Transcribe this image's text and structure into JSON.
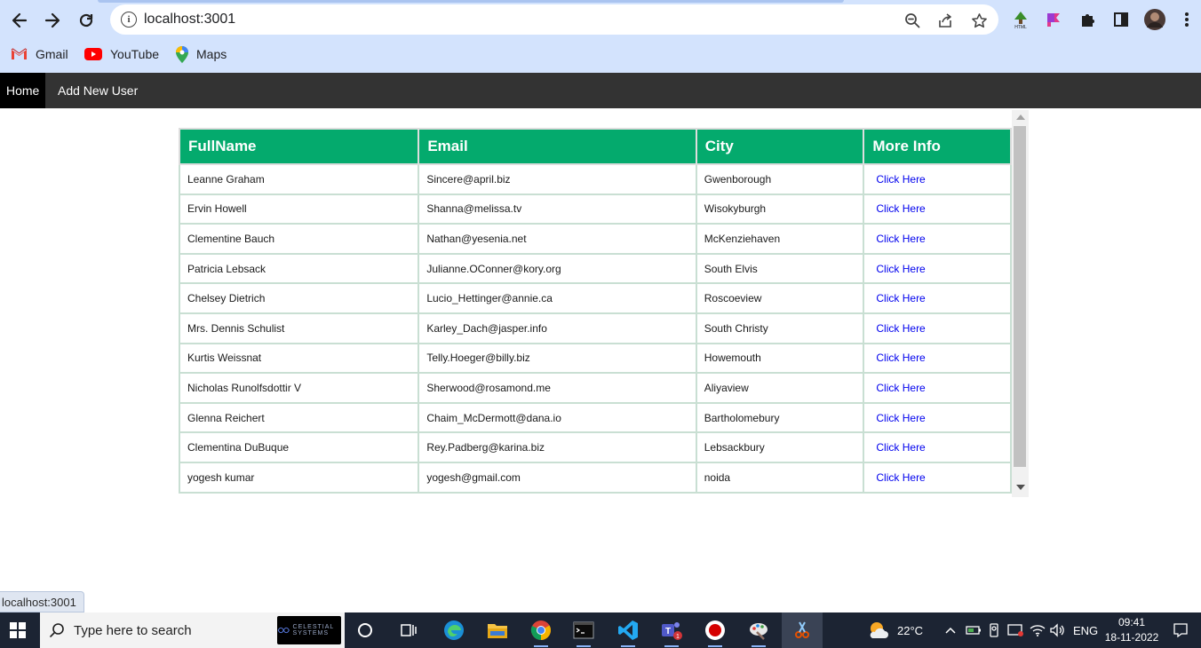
{
  "browser": {
    "url": "localhost:3001",
    "bookmarks": [
      {
        "label": "Gmail"
      },
      {
        "label": "YouTube"
      },
      {
        "label": "Maps"
      }
    ]
  },
  "nav": {
    "home_label": "Home",
    "add_user_label": "Add New User"
  },
  "table": {
    "headers": [
      "FullName",
      "Email",
      "City",
      "More Info"
    ],
    "rows": [
      {
        "name": "Leanne Graham",
        "email": "Sincere@april.biz",
        "city": "Gwenborough",
        "link": "Click Here"
      },
      {
        "name": "Ervin Howell",
        "email": "Shanna@melissa.tv",
        "city": "Wisokyburgh",
        "link": "Click Here"
      },
      {
        "name": "Clementine Bauch",
        "email": "Nathan@yesenia.net",
        "city": "McKenziehaven",
        "link": "Click Here"
      },
      {
        "name": "Patricia Lebsack",
        "email": "Julianne.OConner@kory.org",
        "city": "South Elvis",
        "link": "Click Here"
      },
      {
        "name": "Chelsey Dietrich",
        "email": "Lucio_Hettinger@annie.ca",
        "city": "Roscoeview",
        "link": "Click Here"
      },
      {
        "name": "Mrs. Dennis Schulist",
        "email": "Karley_Dach@jasper.info",
        "city": "South Christy",
        "link": "Click Here"
      },
      {
        "name": "Kurtis Weissnat",
        "email": "Telly.Hoeger@billy.biz",
        "city": "Howemouth",
        "link": "Click Here"
      },
      {
        "name": "Nicholas Runolfsdottir V",
        "email": "Sherwood@rosamond.me",
        "city": "Aliyaview",
        "link": "Click Here"
      },
      {
        "name": "Glenna Reichert",
        "email": "Chaim_McDermott@dana.io",
        "city": "Bartholomebury",
        "link": "Click Here"
      },
      {
        "name": "Clementina DuBuque",
        "email": "Rey.Padberg@karina.biz",
        "city": "Lebsackbury",
        "link": "Click Here"
      },
      {
        "name": "yogesh kumar",
        "email": "yogesh@gmail.com",
        "city": "noida",
        "link": "Click Here"
      }
    ]
  },
  "status_bar": {
    "text": "localhost:3001"
  },
  "taskbar": {
    "search_placeholder": "Type here to search",
    "promo_text": "CELESTIAL SYSTEMS",
    "weather": "22°C",
    "language": "ENG",
    "time": "09:41",
    "date": "18-11-2022"
  },
  "colors": {
    "header_green": "#04aa6d",
    "navbar": "#333333",
    "link": "#0000ee",
    "chrome_bg": "#d3e3fd"
  }
}
